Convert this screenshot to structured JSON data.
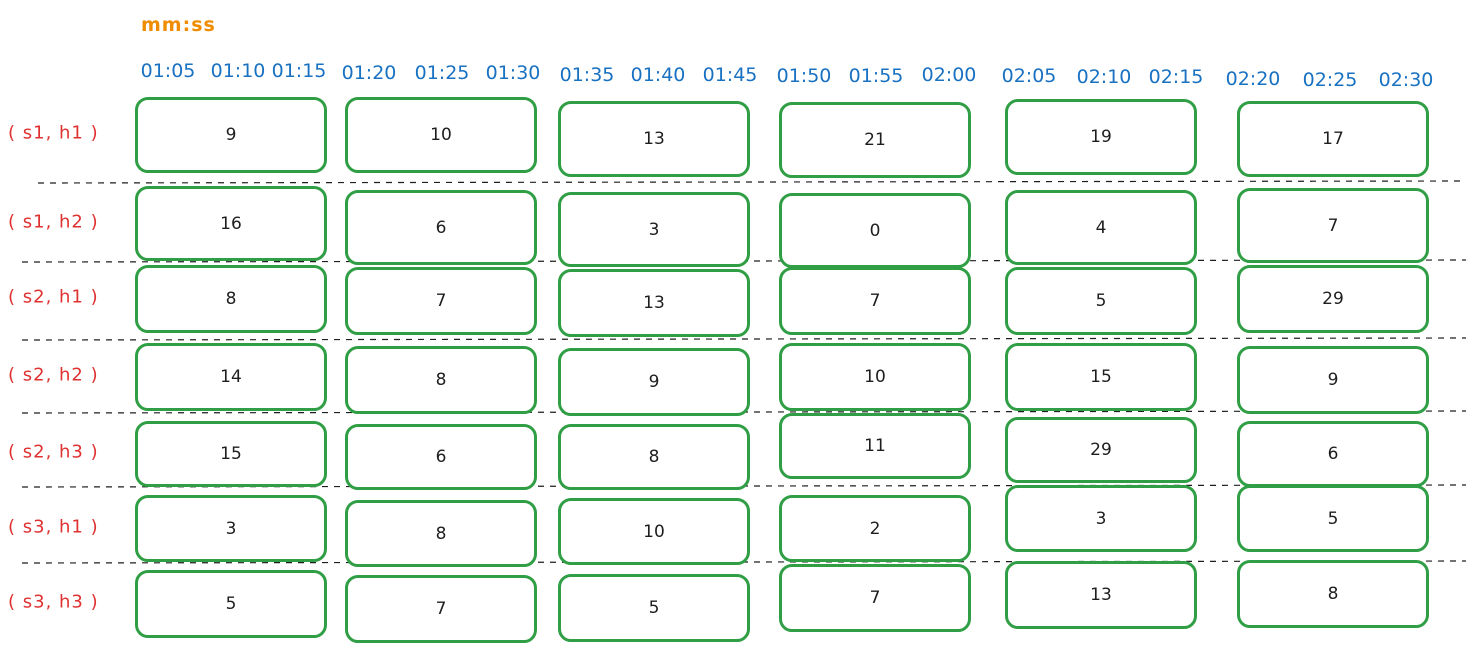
{
  "time_unit": "mm:ss",
  "time_ticks": [
    "01:05",
    "01:10",
    "01:15",
    "01:20",
    "01:25",
    "01:30",
    "01:35",
    "01:40",
    "01:45",
    "01:50",
    "01:55",
    "02:00",
    "02:05",
    "02:10",
    "02:15",
    "02:20",
    "02:25",
    "02:30"
  ],
  "rows": [
    {
      "label": "( s1, h1 )",
      "values": [
        "9",
        "10",
        "13",
        "21",
        "19",
        "17"
      ]
    },
    {
      "label": "( s1, h2 )",
      "values": [
        "16",
        "6",
        "3",
        "0",
        "4",
        "7"
      ]
    },
    {
      "label": "( s2, h1 )",
      "values": [
        "8",
        "7",
        "13",
        "7",
        "5",
        "29"
      ]
    },
    {
      "label": "( s2, h2 )",
      "values": [
        "14",
        "8",
        "9",
        "10",
        "15",
        "9"
      ]
    },
    {
      "label": "( s2, h3 )",
      "values": [
        "15",
        "6",
        "8",
        "11",
        "29",
        "6"
      ]
    },
    {
      "label": "( s3, h1 )",
      "values": [
        "3",
        "8",
        "10",
        "2",
        "3",
        "5"
      ]
    },
    {
      "label": "( s3, h3 )",
      "values": [
        "5",
        "7",
        "5",
        "7",
        "13",
        "8"
      ]
    }
  ],
  "colors": {
    "cell_border": "#2f9e44",
    "row_label": "#e03131",
    "time_tick": "#1971c2",
    "unit_label": "#f08c00",
    "divider": "#1e1e1e"
  }
}
